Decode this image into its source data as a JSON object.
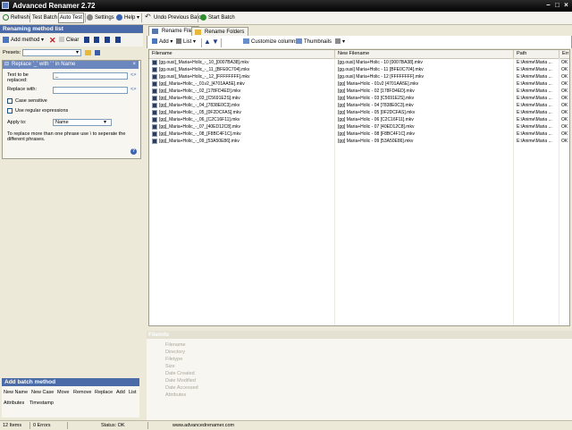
{
  "window": {
    "title": "Advanced Renamer 2.72"
  },
  "toolbar": {
    "refresh": "Refresh",
    "test_batch": "Test Batch",
    "auto_test": "Auto Test",
    "settings": "Settings",
    "help": "Help",
    "undo": "Undo Previous Batch",
    "start": "Start Batch"
  },
  "left_panel": {
    "header": "Renaming method list",
    "add_method": "Add method",
    "clear": "Clear",
    "presets_label": "Presets:",
    "presets_value": ""
  },
  "method": {
    "title": "Replace '_' with ' ' in Name",
    "text_label_1": "Text to be",
    "text_label_2": "replaced:",
    "text_value": "_",
    "replace_label": "Replace with:",
    "replace_value": "",
    "case_label": "Case sensitive",
    "regex_label": "Use regular expressions",
    "apply_label": "Apply to:",
    "apply_value": "Name",
    "hint_1": "To replace more than one phrase use \\ to seperate the",
    "hint_2": "different phrases."
  },
  "add_batch": {
    "header": "Add batch method",
    "items_row1": [
      "New Name",
      "New Case",
      "Move",
      "Remove",
      "Replace",
      "Add",
      "List"
    ],
    "items_row2": [
      "Attributes",
      "Timestamp"
    ]
  },
  "tabs": {
    "files": "Rename Files",
    "folders": "Rename Folders"
  },
  "list_toolbar": {
    "add": "Add",
    "list": "List",
    "customize": "Customize columns",
    "thumbnails": "Thumbnails"
  },
  "columns": {
    "filename": "Filename",
    "new_filename": "New Filename",
    "path": "Path",
    "error": "Err"
  },
  "rows": [
    {
      "filename": "[gg.ousi]_Maria+Holic_-_10_[0007BA38].mkv",
      "new": "[gg.ousi] Maria+Holic - 10 [0007BA38].mkv",
      "path": "E:\\Anime\\Maria ...",
      "err": "OK"
    },
    {
      "filename": "[gg.ousi]_Maria+Holic_-_11_[BFE0C704].mkv",
      "new": "[gg.ousi] Maria+Holic - 11 [BFE0C704].mkv",
      "path": "E:\\Anime\\Maria ...",
      "err": "OK"
    },
    {
      "filename": "[gg.ousi]_Maria+Holic_-_12_[FFFFFFFF].mkv",
      "new": "[gg.ousi] Maria+Holic - 12 [FFFFFFFF].mkv",
      "path": "E:\\Anime\\Maria ...",
      "err": "OK"
    },
    {
      "filename": "[gg]_Maria+Holic_-_01v2_[4701AA5E].mkv",
      "new": "[gg] Maria+Holic - 01v2 [4701AA5E].mkv",
      "path": "E:\\Anime\\Maria ...",
      "err": "OK"
    },
    {
      "filename": "[gg]_Maria+Holic_-_02_[178FD4ED].mkv",
      "new": "[gg] Maria+Holic - 02 [178FD4ED].mkv",
      "path": "E:\\Anime\\Maria ...",
      "err": "OK"
    },
    {
      "filename": "[gg]_Maria+Holic_-_03_[C5691E2S].mkv",
      "new": "[gg] Maria+Holic - 03 [C5691E2S].mkv",
      "path": "E:\\Anime\\Maria ...",
      "err": "OK"
    },
    {
      "filename": "[gg]_Maria+Holic_-_04_[7838E0C3].mkv",
      "new": "[gg] Maria+Holic - 04 [7838E0C3].mkv",
      "path": "E:\\Anime\\Maria ...",
      "err": "OK"
    },
    {
      "filename": "[gg]_Maria+Holic_-_05_[0F2DCFAS].mkv",
      "new": "[gg] Maria+Holic - 05 [0F2DCFAS].mkv",
      "path": "E:\\Anime\\Maria ...",
      "err": "OK"
    },
    {
      "filename": "[gg]_Maria+Holic_-_06_[C2C16F11].mkv",
      "new": "[gg] Maria+Holic - 06 [C2C16F11].mkv",
      "path": "E:\\Anime\\Maria ...",
      "err": "OK"
    },
    {
      "filename": "[gg]_Maria+Holic_-_07_[40ED12C8].mkv",
      "new": "[gg] Maria+Holic - 07 [40ED12C8].mkv",
      "path": "E:\\Anime\\Maria ...",
      "err": "OK"
    },
    {
      "filename": "[gg]_Maria+Holic_-_08_[F8BC4F1C].mkv",
      "new": "[gg] Maria+Holic - 08 [F8BC4F1C].mkv",
      "path": "E:\\Anime\\Maria ...",
      "err": "OK"
    },
    {
      "filename": "[gg]_Maria+Holic_-_09_[53A50E86].mkv",
      "new": "[gg] Maria+Holic - 09 [53A50E86].mkv",
      "path": "E:\\Anime\\Maria ...",
      "err": "OK"
    }
  ],
  "fileinfo": {
    "header": "Fileinfo",
    "labels": [
      "Filename",
      "Directory",
      "Filetype",
      "Size",
      "Date Created",
      "Date Modified",
      "Date Accessed",
      "Attributes"
    ]
  },
  "status": {
    "items": "12 Items",
    "errors": "0 Errors",
    "status": "Status: OK",
    "url": "www.advancedrenamer.com"
  },
  "colors": {
    "header_blue": "#4a6aa8",
    "method_blue": "#6b87bd",
    "window_bg": "#ece9d8"
  }
}
